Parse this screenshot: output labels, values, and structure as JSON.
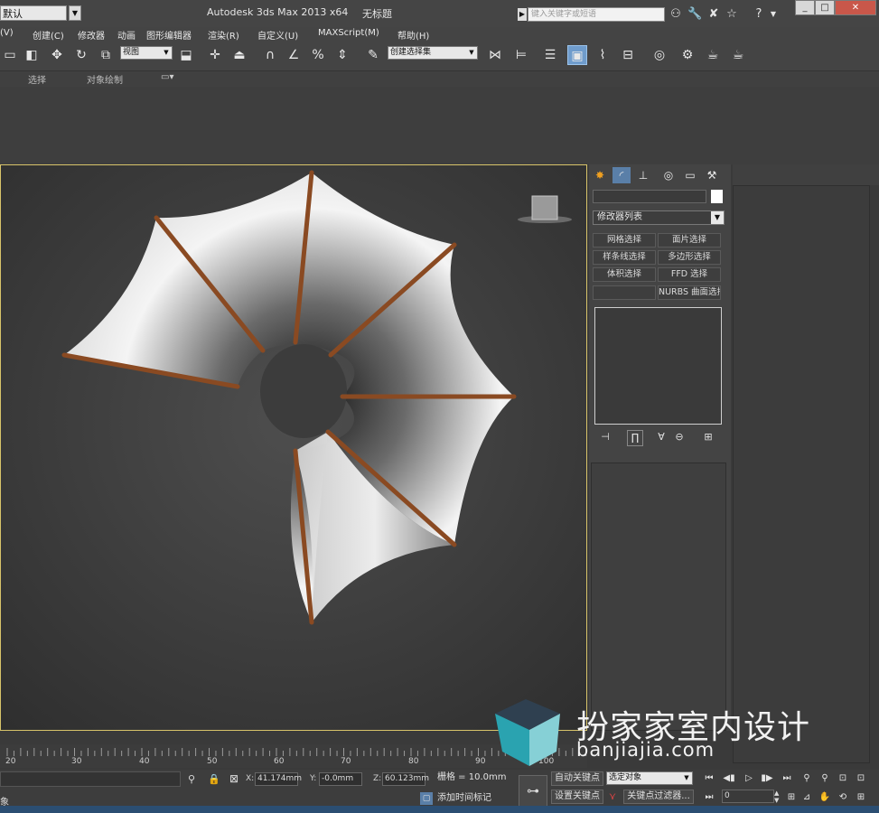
{
  "titlebar": {
    "workspace": "默认",
    "app_title": "Autodesk 3ds Max  2013 x64",
    "doc_title": "无标题",
    "search_placeholder": "键入关键字或短语",
    "window_controls": [
      "_",
      "□",
      "✕"
    ]
  },
  "menu": [
    "(V)",
    "创建(C)",
    "修改器",
    "动画",
    "图形编辑器",
    "渲染(R)",
    "自定义(U)",
    "MAXScript(M)",
    "帮助(H)"
  ],
  "toolbar": {
    "view_dropdown": "视图",
    "selection_set": "创建选择集"
  },
  "ribbon": {
    "tabs": [
      "选择",
      "对象绘制"
    ]
  },
  "command_panel": {
    "modifier_list": "修改器列表",
    "buttons": [
      "网格选择",
      "面片选择",
      "样条线选择",
      "多边形选择",
      "体积选择",
      "FFD 选择",
      "",
      "NURBS 曲面选择"
    ]
  },
  "timeline": {
    "ticks": [
      "20",
      "30",
      "40",
      "50",
      "60",
      "70",
      "80",
      "90",
      "100"
    ]
  },
  "status": {
    "left_text": "象",
    "x_label": "X:",
    "x_value": "41.174mm",
    "y_label": "Y:",
    "y_value": "-0.0mm",
    "z_label": "Z:",
    "z_value": "60.123mm",
    "grid": "栅格 = 10.0mm",
    "add_time_tag": "添加时间标记",
    "auto_key": "自动关键点",
    "selected_object": "选定对象",
    "set_key": "设置关键点",
    "key_filter": "关键点过滤器...",
    "frame": "0"
  },
  "watermark": {
    "text": "扮家家室内设计",
    "url": "banjiajia.com"
  },
  "colors": {
    "viewport_border": "#d8c46a",
    "active_tool": "#6f9ccc",
    "rod": "#8a4a22"
  }
}
